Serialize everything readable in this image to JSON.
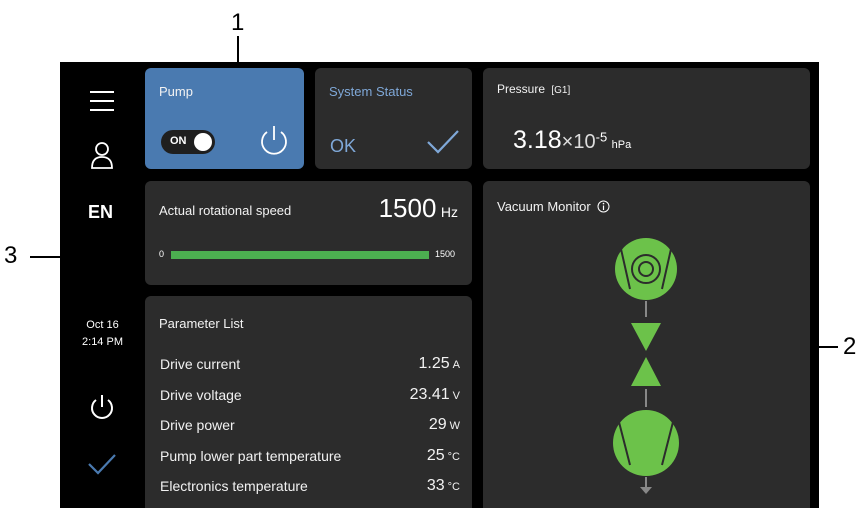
{
  "callouts": {
    "c1": "1",
    "c2": "2",
    "c3": "3"
  },
  "sidebar": {
    "language": "EN",
    "date": "Oct 16",
    "time": "2:14 PM"
  },
  "pump": {
    "title": "Pump",
    "toggle_label": "ON"
  },
  "status": {
    "title": "System Status",
    "value": "OK"
  },
  "pressure": {
    "title": "Pressure",
    "gauge": "[G1]",
    "mantissa": "3.18",
    "times": "×10",
    "exponent": "-5",
    "unit": "hPa"
  },
  "speed": {
    "title": "Actual rotational speed",
    "value": "1500",
    "unit": "Hz",
    "min": "0",
    "max": "1500",
    "fill_fraction": 1.0
  },
  "params": {
    "title": "Parameter List",
    "rows": [
      {
        "label": "Drive current",
        "value": "1.25",
        "unit": "A"
      },
      {
        "label": "Drive voltage",
        "value": "23.41",
        "unit": "V"
      },
      {
        "label": "Drive power",
        "value": "29",
        "unit": "W"
      },
      {
        "label": "Pump lower part temperature",
        "value": "25",
        "unit": "°C"
      },
      {
        "label": "Electronics temperature",
        "value": "33",
        "unit": "°C"
      }
    ]
  },
  "monitor": {
    "title": "Vacuum Monitor"
  },
  "colors": {
    "accent": "#4a7ab0",
    "green": "#6cc24a",
    "card": "#2c2c2c",
    "bar": "#4caf50"
  }
}
